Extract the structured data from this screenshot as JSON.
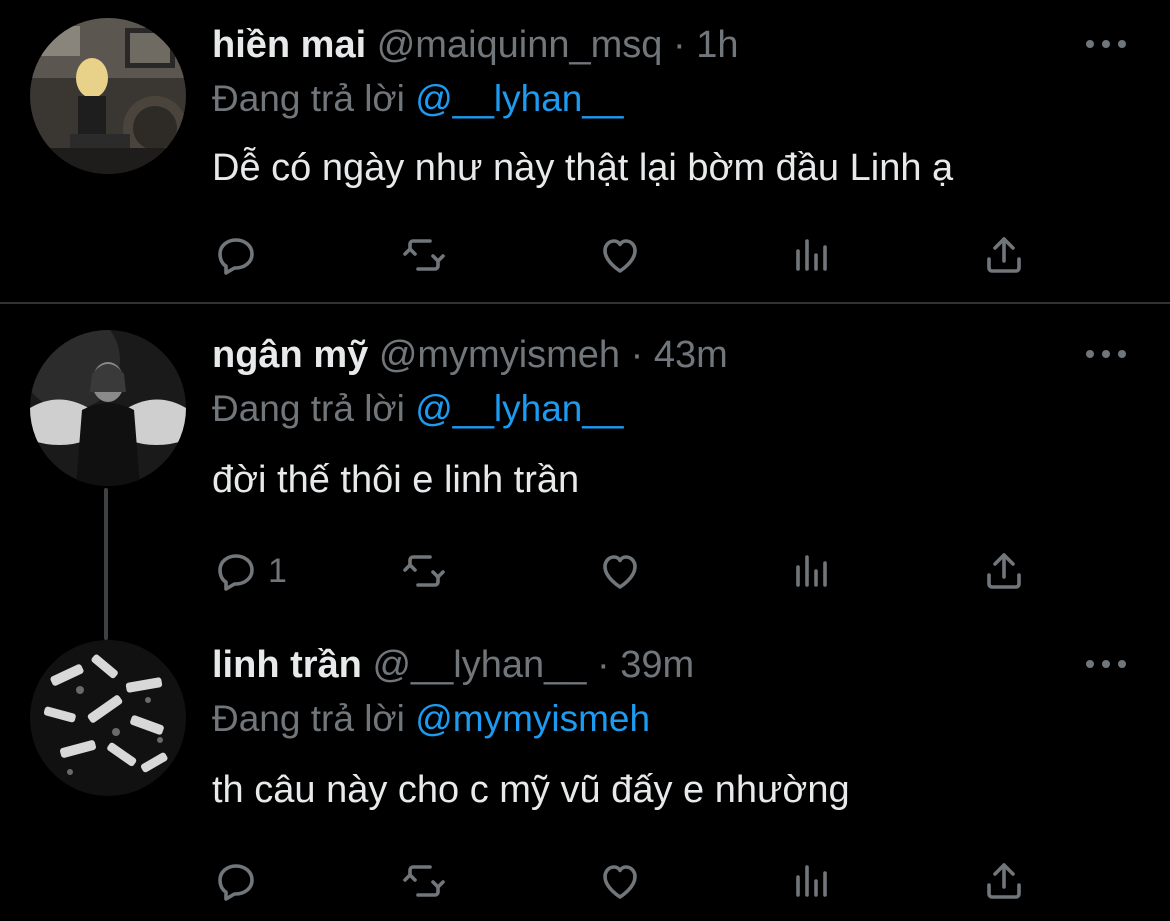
{
  "thread": [
    {
      "name": "hiền mai",
      "handle": "@maiquinn_msq",
      "separator": "·",
      "time": "1h",
      "replying_prefix": "Đang trả lời",
      "replying_to": "@__lyhan__",
      "text": "Dễ có ngày như này thật lại bờm đầu Linh ạ",
      "reply_count": ""
    },
    {
      "name": "ngân mỹ",
      "handle": "@mymyismeh",
      "separator": "·",
      "time": "43m",
      "replying_prefix": "Đang trả lời",
      "replying_to": "@__lyhan__",
      "text": "đời thế thôi e linh trần",
      "reply_count": "1"
    },
    {
      "name": "linh trần",
      "handle": "@__lyhan__",
      "separator": "·",
      "time": "39m",
      "replying_prefix": "Đang trả lời",
      "replying_to": "@mymyismeh",
      "text": "th câu này cho c mỹ vũ đấy e nhường",
      "reply_count": ""
    }
  ],
  "icons": [
    "reply-icon",
    "retweet-icon",
    "like-icon",
    "analytics-icon",
    "share-icon",
    "more-icon"
  ],
  "colors": {
    "background": "#000000",
    "text": "#e7e9ea",
    "muted": "#71767b",
    "link": "#1d9bf0",
    "divider": "#2f3336"
  }
}
